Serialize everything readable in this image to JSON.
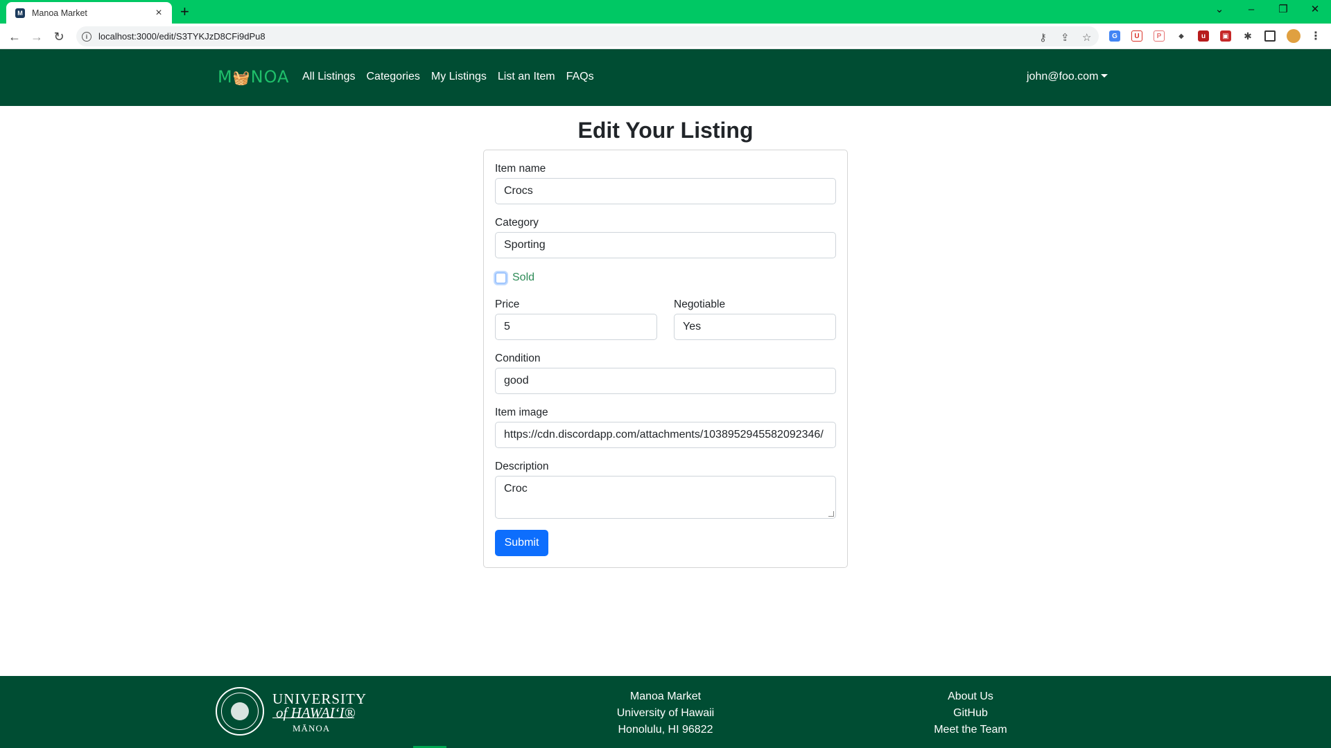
{
  "browser": {
    "tab_title": "Manoa Market",
    "url": "localhost:3000/edit/S3TYKJzD8CFi9dPu8",
    "icons": [
      "back-icon",
      "forward-icon",
      "reload-icon",
      "info-icon",
      "key-icon",
      "share-icon",
      "star-icon",
      "extensions-icon",
      "sidebar-icon",
      "profile-avatar",
      "menu-icon"
    ]
  },
  "nav": {
    "brand": "M🧺NOA",
    "brand_prefix": "M",
    "brand_suffix": "NOA",
    "links": [
      "All Listings",
      "Categories",
      "My Listings",
      "List an Item",
      "FAQs"
    ],
    "user": "john@foo.com"
  },
  "page": {
    "title": "Edit Your Listing"
  },
  "form": {
    "item_name_label": "Item name",
    "item_name_value": "Crocs",
    "category_label": "Category",
    "category_value": "Sporting",
    "sold_label": "Sold",
    "sold_checked": false,
    "price_label": "Price",
    "price_value": "5",
    "negotiable_label": "Negotiable",
    "negotiable_value": "Yes",
    "condition_label": "Condition",
    "condition_value": "good",
    "image_label": "Item image",
    "image_value": "https://cdn.discordapp.com/attachments/1038952945582092346/",
    "description_label": "Description",
    "description_value": "Croc",
    "submit_label": "Submit"
  },
  "footer": {
    "uh_line1": "UNIVERSITY",
    "uh_line2": "of HAWAIʻI®",
    "uh_line3": "MĀNOA",
    "col_center": [
      "Manoa Market",
      "University of Hawaii",
      "Honolulu, HI 96822"
    ],
    "col_right": [
      "About Us",
      "GitHub",
      "Meet the Team"
    ]
  },
  "colors": {
    "tabbar": "#00c864",
    "navbar": "#004d33",
    "brand": "#1fbf6a",
    "primary": "#0d6efd"
  }
}
